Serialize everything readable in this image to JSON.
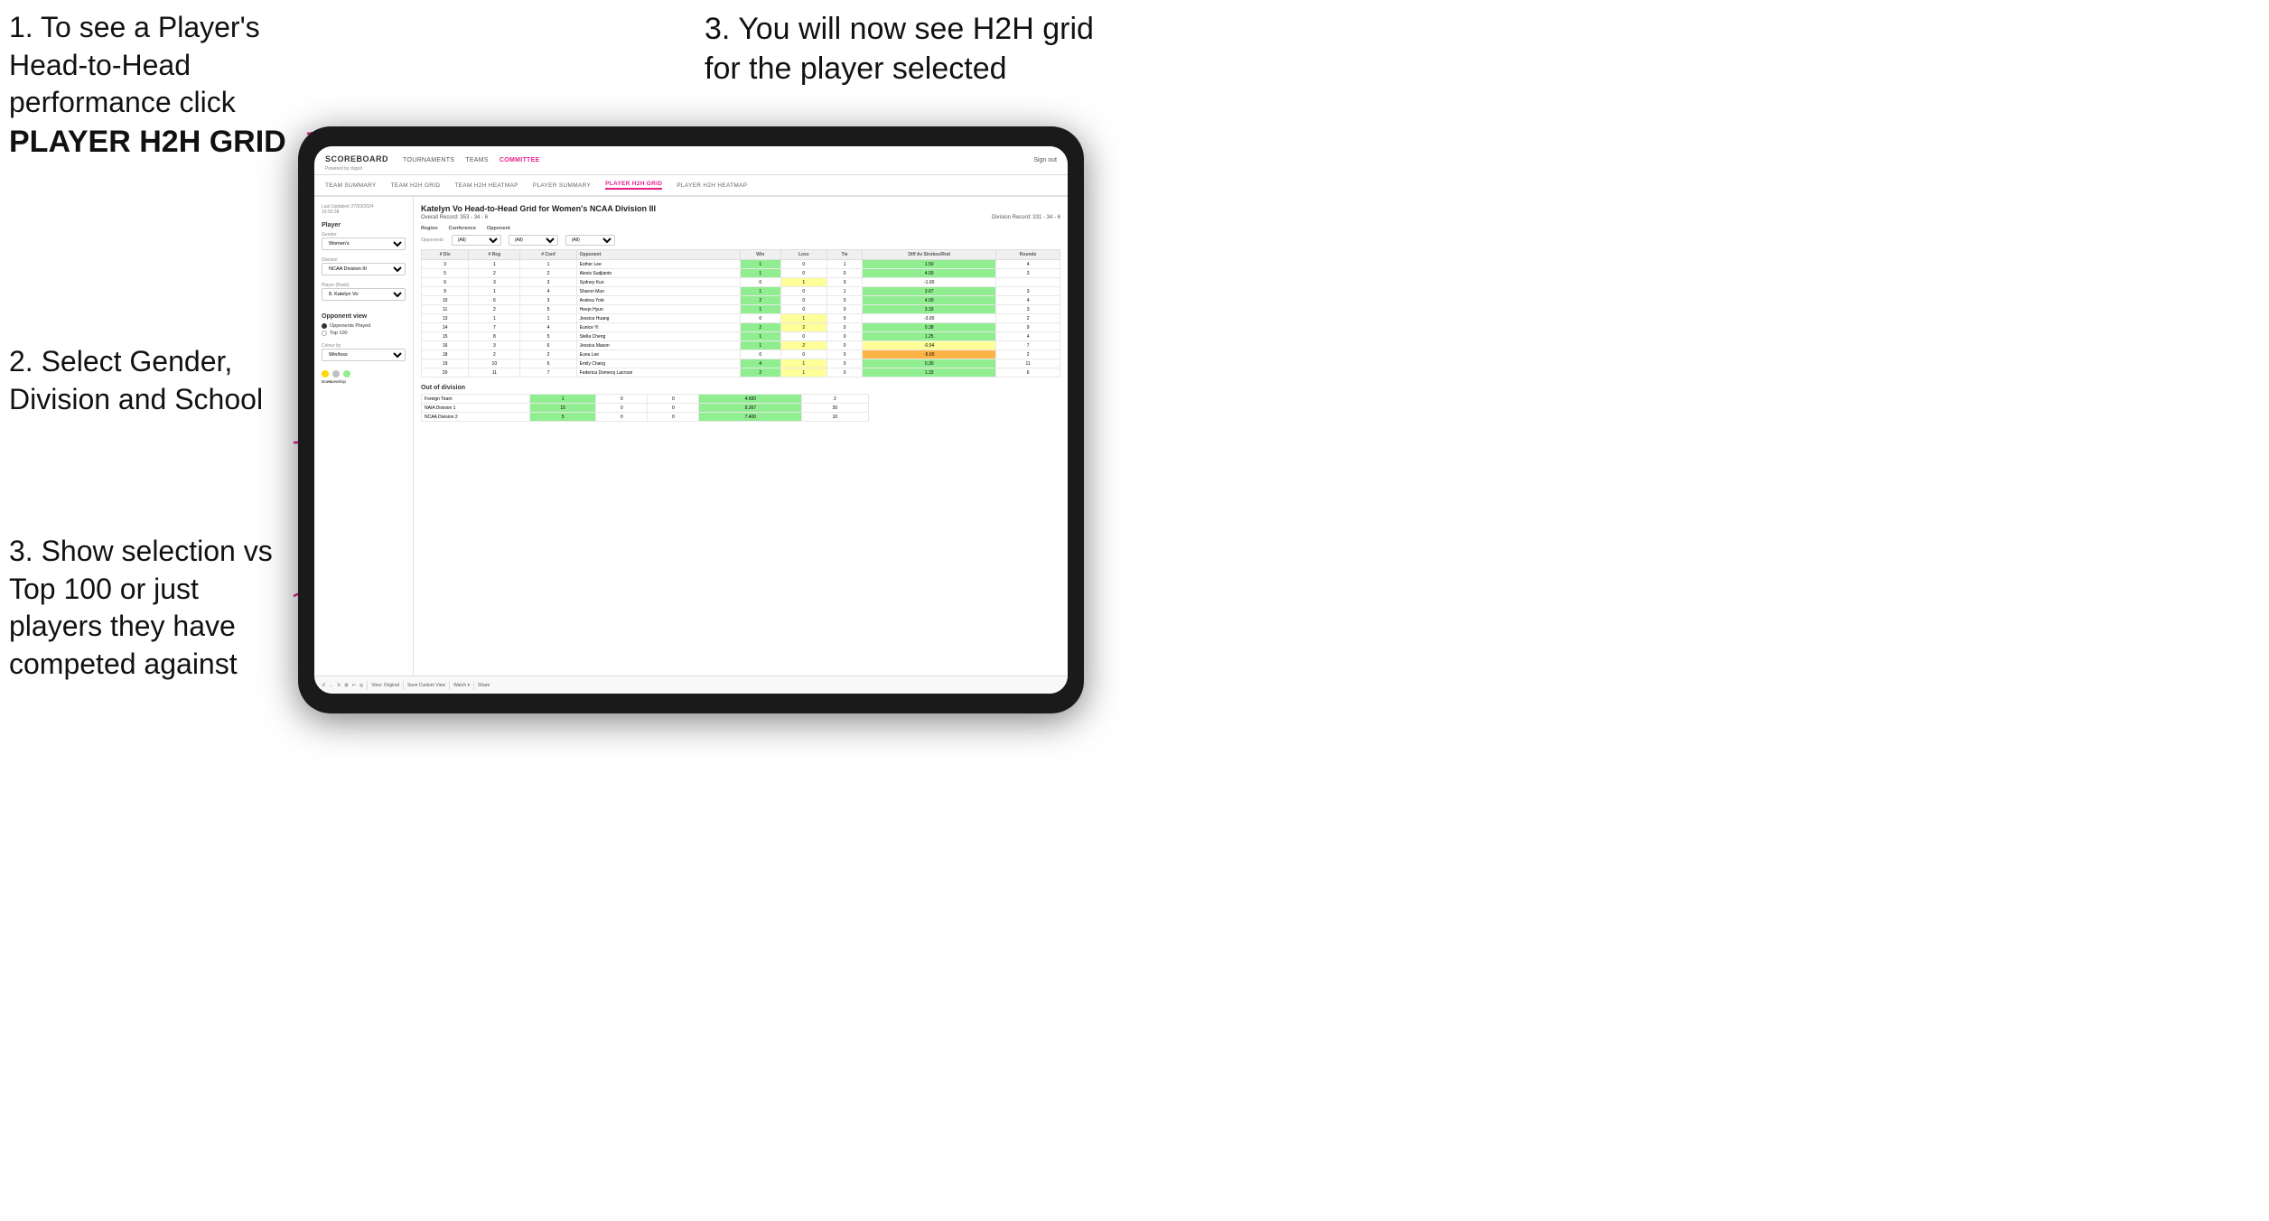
{
  "instructions": {
    "step1_text": "1. To see a Player's Head-to-Head performance click",
    "step1_bold": "PLAYER H2H GRID",
    "step2_text": "2. Select Gender, Division and School",
    "step3_left_text": "3. Show selection vs Top 100 or just players they have competed against",
    "step3_right_text": "3. You will now see H2H grid for the player selected"
  },
  "nav": {
    "logo": "SCOREBOARD",
    "logo_sub": "Powered by clippd",
    "links": [
      "TOURNAMENTS",
      "TEAMS",
      "COMMITTEE"
    ],
    "active_link": "COMMITTEE",
    "sign_out": "Sign out"
  },
  "sub_nav": {
    "links": [
      "TEAM SUMMARY",
      "TEAM H2H GRID",
      "TEAM H2H HEATMAP",
      "PLAYER SUMMARY",
      "PLAYER H2H GRID",
      "PLAYER H2H HEATMAP"
    ],
    "active": "PLAYER H2H GRID"
  },
  "left_panel": {
    "timestamp": "Last Updated: 27/03/2024",
    "time": "16:55:38",
    "player_label": "Player",
    "gender_label": "Gender",
    "gender_value": "Women's",
    "division_label": "Division",
    "division_value": "NCAA Division III",
    "player_rank_label": "Player (Rank)",
    "player_rank_value": "8. Katelyn Vo",
    "opponent_view_label": "Opponent view",
    "radio_options": [
      "Opponents Played",
      "Top 100"
    ],
    "radio_selected": "Opponents Played",
    "colour_by_label": "Colour by",
    "colour_by_value": "Win/loss",
    "legend_labels": [
      "Down",
      "Level",
      "Up"
    ],
    "legend_colors": [
      "#FFD700",
      "#C0C0C0",
      "#90EE90"
    ]
  },
  "grid": {
    "title": "Katelyn Vo Head-to-Head Grid for Women's NCAA Division III",
    "overall_record": "Overall Record: 353 - 34 - 6",
    "division_record": "Division Record: 331 - 34 - 6",
    "region_label": "Region",
    "conference_label": "Conference",
    "opponent_label": "Opponent",
    "opponents_label": "Opponents:",
    "filter_all": "(All)",
    "col_headers": [
      "# Div",
      "# Reg",
      "# Conf",
      "Opponent",
      "Win",
      "Loss",
      "Tie",
      "Diff Av Strokes/Rnd",
      "Rounds"
    ],
    "rows": [
      {
        "div": 3,
        "reg": 1,
        "conf": 1,
        "name": "Esther Lee",
        "win": 1,
        "loss": 0,
        "tie": 1,
        "diff": "1.50",
        "rounds": 4,
        "win_color": "green",
        "loss_color": "white"
      },
      {
        "div": 5,
        "reg": 2,
        "conf": 2,
        "name": "Alexis Sudjianto",
        "win": 1,
        "loss": 0,
        "tie": 0,
        "diff": "4.00",
        "rounds": 3,
        "win_color": "green"
      },
      {
        "div": 6,
        "reg": 3,
        "conf": 3,
        "name": "Sydney Kuo",
        "win": 0,
        "loss": 1,
        "tie": 0,
        "diff": "-1.00",
        "rounds": "",
        "win_color": "white",
        "loss_color": "yellow"
      },
      {
        "div": 9,
        "reg": 1,
        "conf": 4,
        "name": "Sharon Mun",
        "win": 1,
        "loss": 0,
        "tie": 1,
        "diff": "3.67",
        "rounds": 3,
        "win_color": "green"
      },
      {
        "div": 10,
        "reg": 6,
        "conf": 3,
        "name": "Andrea York",
        "win": 2,
        "loss": 0,
        "tie": 0,
        "diff": "4.00",
        "rounds": 4,
        "win_color": "green"
      },
      {
        "div": 11,
        "reg": 2,
        "conf": 5,
        "name": "Heejo Hyun",
        "win": 1,
        "loss": 0,
        "tie": 0,
        "diff": "3.33",
        "rounds": 3,
        "win_color": "green"
      },
      {
        "div": 13,
        "reg": 1,
        "conf": 1,
        "name": "Jessica Huang",
        "win": 0,
        "loss": 1,
        "tie": 0,
        "diff": "-3.00",
        "rounds": 2,
        "win_color": "white",
        "loss_color": "yellow"
      },
      {
        "div": 14,
        "reg": 7,
        "conf": 4,
        "name": "Eunice Yi",
        "win": 2,
        "loss": 2,
        "tie": 0,
        "diff": "0.38",
        "rounds": 9,
        "win_color": "green"
      },
      {
        "div": 15,
        "reg": 8,
        "conf": 5,
        "name": "Stella Cheng",
        "win": 1,
        "loss": 0,
        "tie": 0,
        "diff": "1.25",
        "rounds": 4,
        "win_color": "green"
      },
      {
        "div": 16,
        "reg": 3,
        "conf": 6,
        "name": "Jessica Mason",
        "win": 1,
        "loss": 2,
        "tie": 0,
        "diff": "-0.94",
        "rounds": 7,
        "win_color": "yellow"
      },
      {
        "div": 18,
        "reg": 2,
        "conf": 2,
        "name": "Euna Lee",
        "win": 0,
        "loss": 0,
        "tie": 0,
        "diff": "-5.00",
        "rounds": 2,
        "win_color": "orange"
      },
      {
        "div": 19,
        "reg": 10,
        "conf": 6,
        "name": "Emily Chang",
        "win": 4,
        "loss": 1,
        "tie": 0,
        "diff": "0.30",
        "rounds": 11,
        "win_color": "green"
      },
      {
        "div": 20,
        "reg": 11,
        "conf": 7,
        "name": "Federica Domecq Lacroze",
        "win": 2,
        "loss": 1,
        "tie": 0,
        "diff": "1.33",
        "rounds": 6,
        "win_color": "green"
      }
    ],
    "out_of_division_label": "Out of division",
    "out_of_division_rows": [
      {
        "name": "Foreign Team",
        "win": 1,
        "loss": 0,
        "tie": 0,
        "diff": "4.500",
        "rounds": 2,
        "color": "green"
      },
      {
        "name": "NAIA Division 1",
        "win": 15,
        "loss": 0,
        "tie": 0,
        "diff": "9.267",
        "rounds": 30,
        "color": "green"
      },
      {
        "name": "NCAA Division 2",
        "win": 5,
        "loss": 0,
        "tie": 0,
        "diff": "7.400",
        "rounds": 10,
        "color": "green"
      }
    ]
  },
  "toolbar": {
    "buttons": [
      "↺",
      "←",
      "↻",
      "⊞",
      "↩",
      "◎"
    ],
    "view_original": "View: Original",
    "save_custom": "Save Custom View",
    "watch": "Watch ▾",
    "share": "Share"
  }
}
